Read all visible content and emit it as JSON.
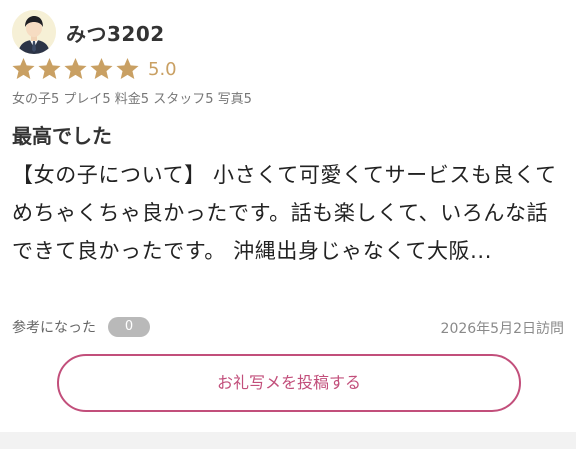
{
  "reviewer": {
    "name": "みつ3202",
    "avatar_icon": "businessman-avatar-icon"
  },
  "rating": {
    "stars": 5,
    "max_stars": 5,
    "value_label": "5.0",
    "star_color": "#c9a063"
  },
  "scores_text": "女の子5 プレイ5 料金5 スタッフ5 写真5",
  "review": {
    "title": "最高でした",
    "body": "【女の子について】 小さくて可愛くてサービスも良くてめちゃくちゃ良かったです。話も楽しくて、いろんな話できて良かったです。 沖縄出身じゃなくて大阪..."
  },
  "helpful": {
    "label": "参考になった",
    "count": "0"
  },
  "visit_date": "2026年5月2日訪問",
  "thanks_button": {
    "label": "お礼写メを投稿する",
    "accent": "#c24f7b"
  }
}
